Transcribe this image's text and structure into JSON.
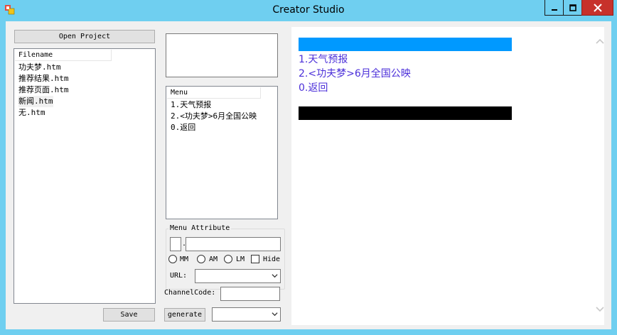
{
  "window": {
    "title": "Creator Studio"
  },
  "left": {
    "open_project_label": "Open Project",
    "file_list_header": "Filename",
    "files": [
      "功夫梦.htm",
      "推荐结果.htm",
      "推荐页面.htm",
      "新闻.htm",
      "无.htm"
    ],
    "save_label": "Save"
  },
  "menu": {
    "header": "Menu",
    "items": [
      "1.天气预报",
      "2.<功夫梦>6月全国公映",
      "0.返回"
    ]
  },
  "menu_attribute": {
    "group_label": "Menu Attribute",
    "separator": ".",
    "radio_options": [
      "MM",
      "AM",
      "LM"
    ],
    "hide_label": "Hide",
    "url_label": "URL:",
    "url_value": ""
  },
  "channel": {
    "label": "ChannelCode:",
    "value": ""
  },
  "generate_label": "generate",
  "generate_select_value": "",
  "preview": {
    "lines": [
      "1.天气预报",
      "2.<功夫梦>6月全国公映",
      "0.返回"
    ]
  },
  "colors": {
    "titlebar": "#6fcff0",
    "preview_bar": "#0099ff",
    "preview_text": "#4b2fd9",
    "close_button": "#c7312b"
  },
  "icons": [
    "app-icon",
    "minimize-icon",
    "maximize-icon",
    "close-icon",
    "chevron-down-icon",
    "scroll-up-icon",
    "scroll-down-icon"
  ]
}
